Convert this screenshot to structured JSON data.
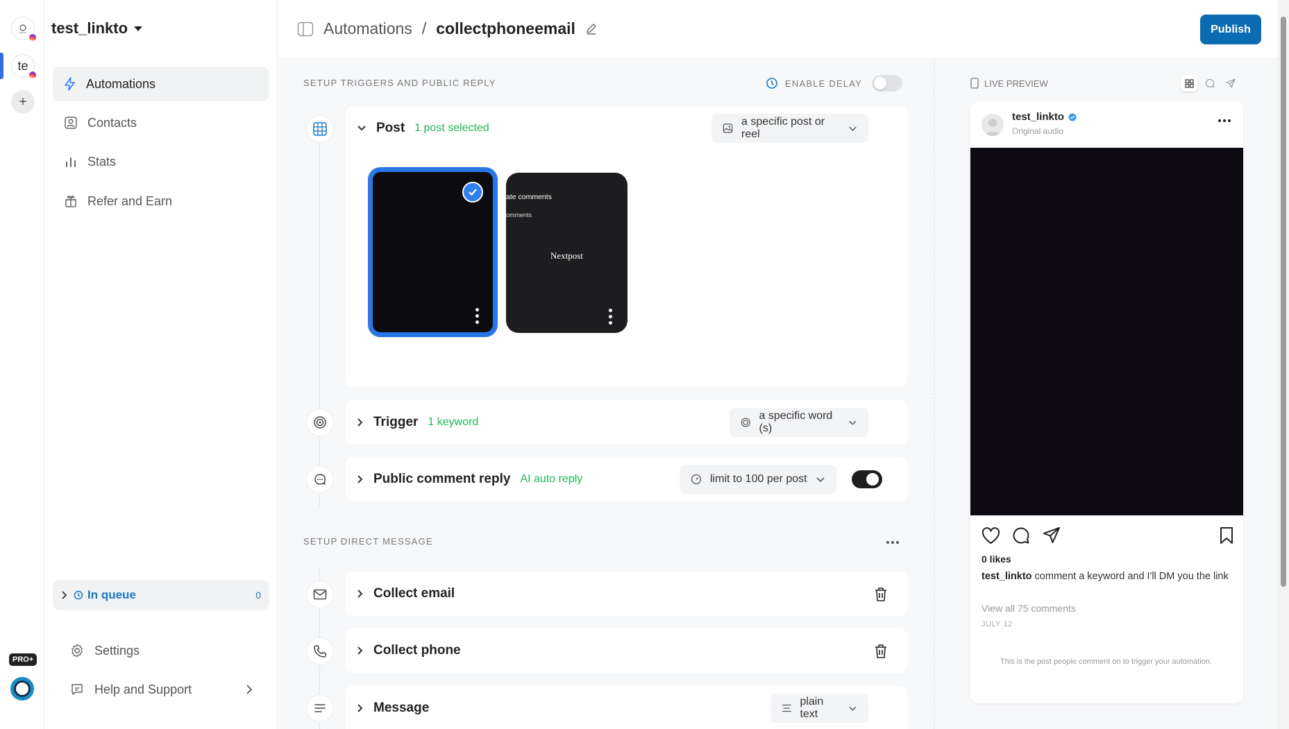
{
  "rail": {
    "accounts": [
      {
        "initials": ""
      },
      {
        "initials": "te"
      }
    ],
    "add_label": "+",
    "pro_badge": "PRO+"
  },
  "sidebar": {
    "account_name": "test_linkto",
    "nav": [
      {
        "label": "Automations",
        "icon": "bolt-icon",
        "active": true
      },
      {
        "label": "Contacts",
        "icon": "contact-card-icon"
      },
      {
        "label": "Stats",
        "icon": "bar-chart-icon"
      },
      {
        "label": "Refer and Earn",
        "icon": "gift-icon"
      }
    ],
    "queue": {
      "label": "In queue",
      "count": "0"
    },
    "settings_label": "Settings",
    "help_label": "Help and Support"
  },
  "header": {
    "crumb_parent": "Automations",
    "separator": "/",
    "crumb_current": "collectphoneemail",
    "publish_label": "Publish"
  },
  "triggers": {
    "section_title": "SETUP TRIGGERS AND PUBLIC REPLY",
    "delay_label": "ENABLE DELAY",
    "delay_enabled": false,
    "post": {
      "title": "Post",
      "status": "1 post selected",
      "select_value": "a specific post or reel",
      "thumb2_line1": "ate comments",
      "thumb2_line2": "omments",
      "thumb2_center": "Nextpost"
    },
    "trigger": {
      "title": "Trigger",
      "status": "1 keyword",
      "select_value": "a specific word (s)"
    },
    "public_reply": {
      "title": "Public comment reply",
      "status": "AI auto reply",
      "select_value": "limit to 100 per post",
      "enabled": true
    }
  },
  "dm": {
    "section_title": "SETUP DIRECT MESSAGE",
    "steps": [
      {
        "title": "Collect email"
      },
      {
        "title": "Collect phone"
      },
      {
        "title": "Message",
        "select_value": "plain text"
      }
    ]
  },
  "preview": {
    "label": "LIVE PREVIEW",
    "username": "test_linkto",
    "audio": "Original audio",
    "likes": "0 likes",
    "caption_user": "test_linkto",
    "caption_text": "comment a keyword and I'll DM you the link",
    "view_comments": "View all 75 comments",
    "date": "JULY 12",
    "hint": "This is the post people comment on to trigger your automation."
  }
}
